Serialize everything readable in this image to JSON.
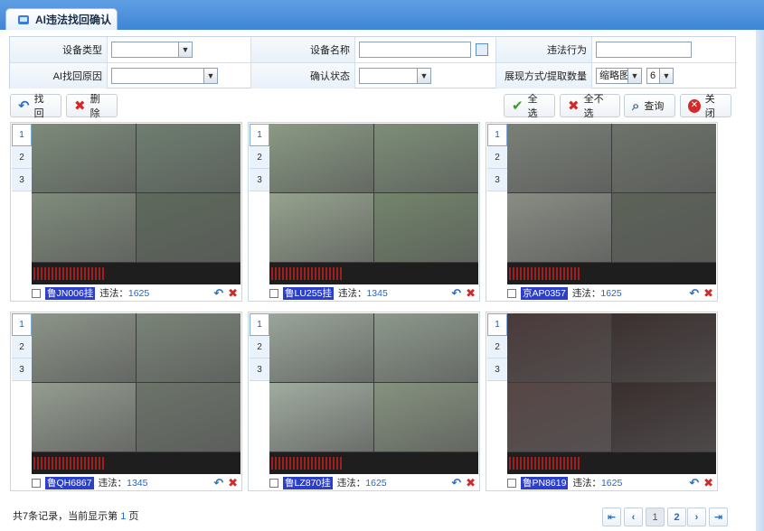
{
  "tab": {
    "title": "AI违法找回确认"
  },
  "form": {
    "device_type_label": "设备类型",
    "device_type_value": "",
    "device_name_label": "设备名称",
    "device_name_value": "",
    "violation_label": "违法行为",
    "violation_value": "",
    "reason_label": "AI找回原因",
    "reason_value": "",
    "confirm_label": "确认状态",
    "confirm_value": "",
    "display_label": "展现方式/提取数量",
    "display_mode": "缩略图",
    "display_count": "6"
  },
  "toolbar": {
    "back": "找回",
    "delete": "删除",
    "select_all": "全选",
    "deselect_all": "全不选",
    "query": "查询",
    "close": "关闭"
  },
  "cards": [
    {
      "tabs": [
        "1",
        "2",
        "3"
      ],
      "plate": "鲁JN006挂",
      "violation_label": "违法：",
      "violation_code": "1625"
    },
    {
      "tabs": [
        "1",
        "2",
        "3"
      ],
      "plate": "鲁LU255挂",
      "violation_label": "违法：",
      "violation_code": "1345"
    },
    {
      "tabs": [
        "1",
        "2",
        "3"
      ],
      "plate": "京AP0357",
      "violation_label": "违法：",
      "violation_code": "1625"
    },
    {
      "tabs": [
        "1",
        "2",
        "3"
      ],
      "plate": "鲁QH6867",
      "violation_label": "违法：",
      "violation_code": "1345"
    },
    {
      "tabs": [
        "1",
        "2",
        "3"
      ],
      "plate": "鲁LZ870挂",
      "violation_label": "违法：",
      "violation_code": "1625"
    },
    {
      "tabs": [
        "1",
        "2",
        "3"
      ],
      "plate": "鲁PN8619",
      "violation_label": "违法：",
      "violation_code": "1625"
    }
  ],
  "footer": {
    "prefix": "共7条记录，当前显示第",
    "page": "1",
    "suffix": "页"
  },
  "pager": {
    "first": "⇤",
    "prev": "‹",
    "p1": "1",
    "p2": "2",
    "next": "›",
    "last": "⇥"
  },
  "icons": {
    "back": "undo-icon",
    "delete": "x-icon",
    "select_all": "check-icon",
    "deselect_all": "x-icon",
    "query": "magnifier-icon",
    "close": "close-circle-icon"
  },
  "colors": {
    "header": "#3f85d6",
    "plate_bg": "#2c3fc9",
    "link": "#2468c8",
    "danger": "#d22a2a"
  }
}
